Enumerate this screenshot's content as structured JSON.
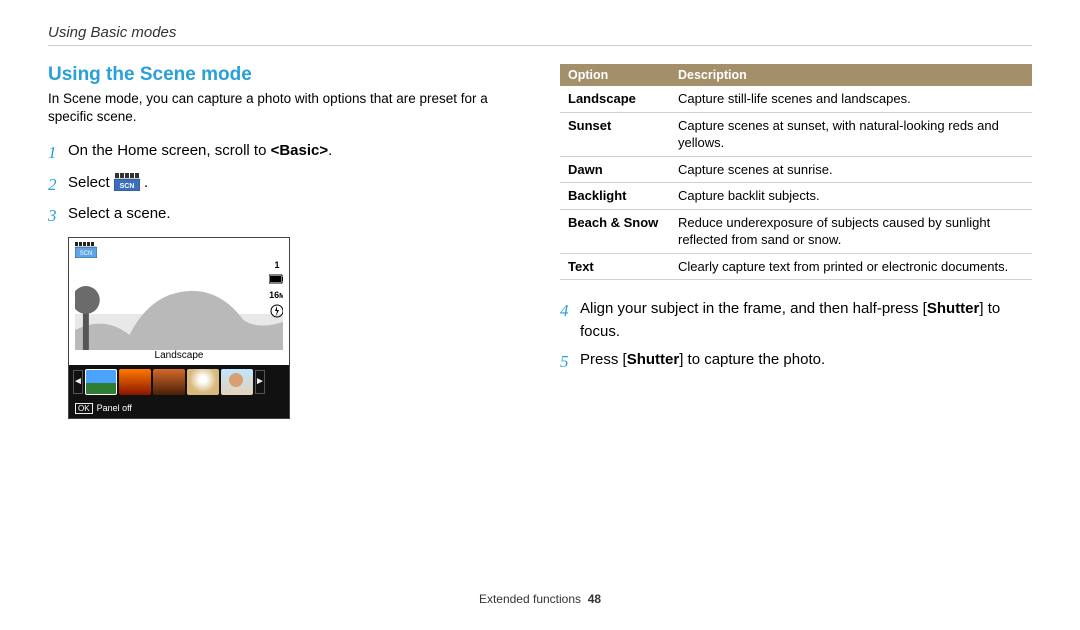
{
  "breadcrumb": "Using Basic modes",
  "section_title": "Using the Scene mode",
  "intro": "In Scene mode, you can capture a photo with options that are preset for a specific scene.",
  "steps_left": [
    {
      "n": "1",
      "pre": "On the Home screen, scroll to ",
      "bold": "<Basic>",
      "post": "."
    },
    {
      "n": "2",
      "pre": "Select ",
      "icon": true,
      "post": " ."
    },
    {
      "n": "3",
      "pre": "Select a scene.",
      "bold": "",
      "post": ""
    }
  ],
  "screenshot": {
    "top_counter": "1",
    "res_label": "16M",
    "mode_label": "Landscape",
    "panel_label": "Panel off",
    "ok": "OK"
  },
  "table_headers": {
    "option": "Option",
    "description": "Description"
  },
  "options": [
    {
      "name": "Landscape",
      "desc": "Capture still-life scenes and landscapes."
    },
    {
      "name": "Sunset",
      "desc": "Capture scenes at sunset, with natural-looking reds and yellows."
    },
    {
      "name": "Dawn",
      "desc": "Capture scenes at sunrise."
    },
    {
      "name": "Backlight",
      "desc": "Capture backlit subjects."
    },
    {
      "name": "Beach & Snow",
      "desc": "Reduce underexposure of subjects caused by sunlight reflected from sand or snow."
    },
    {
      "name": "Text",
      "desc": "Clearly capture text from printed or electronic documents."
    }
  ],
  "steps_right": [
    {
      "n": "4",
      "parts": [
        "Align your subject in the frame, and then half-press [",
        "Shutter",
        "] to focus."
      ]
    },
    {
      "n": "5",
      "parts": [
        "Press [",
        "Shutter",
        "] to capture the photo."
      ]
    }
  ],
  "footer": {
    "section": "Extended functions",
    "page": "48"
  }
}
